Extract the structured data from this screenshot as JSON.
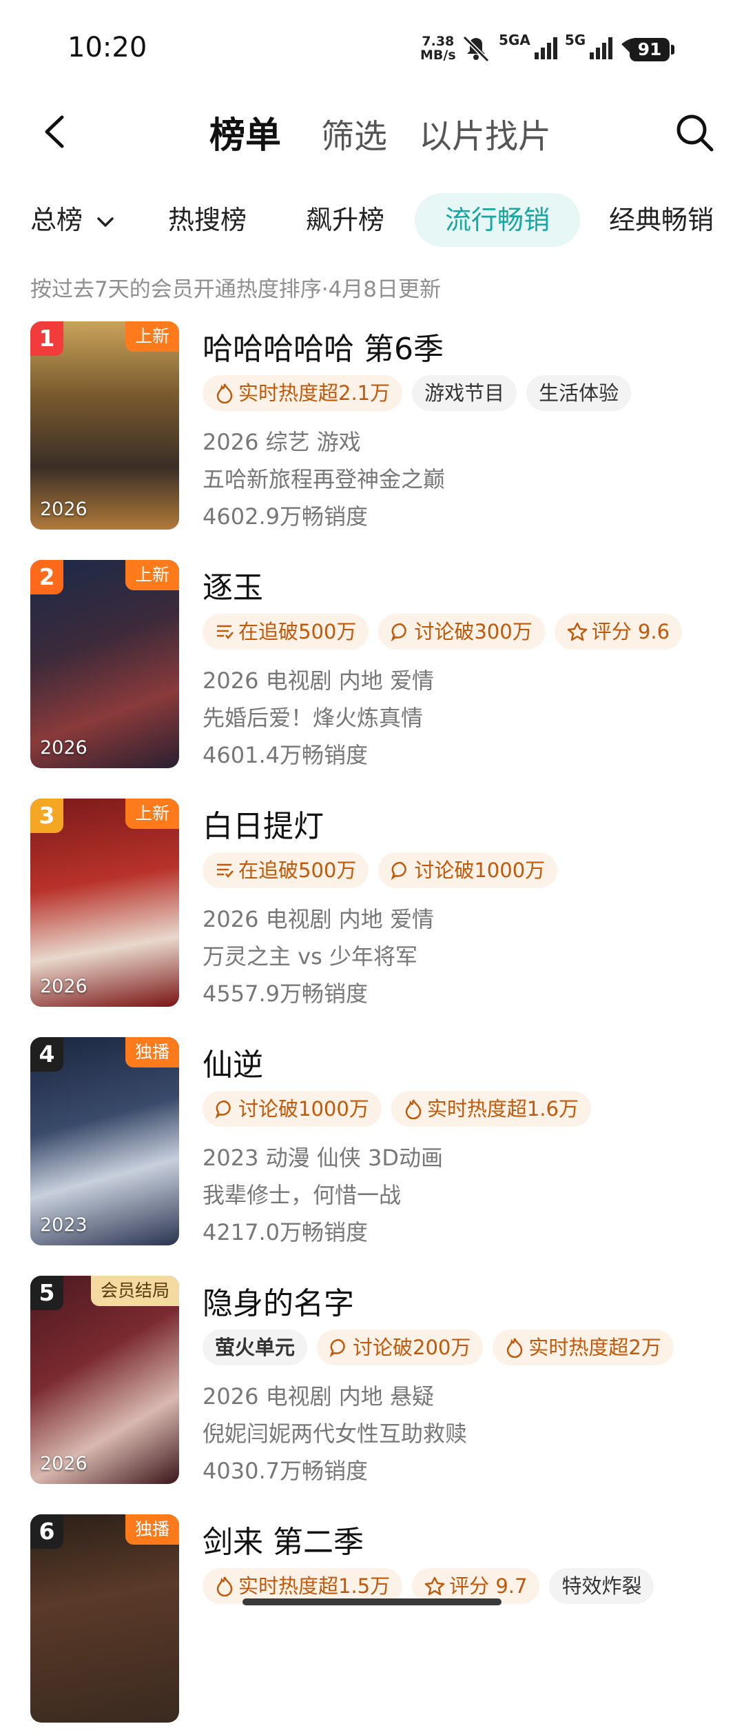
{
  "status": {
    "time": "10:20",
    "net_speed_value": "7.38",
    "net_speed_unit": "MB/s",
    "sim1_label": "5GA",
    "sim2_label": "5G",
    "wifi_label": "6",
    "battery": "91"
  },
  "header": {
    "tabs": [
      "榜单",
      "筛选",
      "以片找片"
    ]
  },
  "categories": [
    "总榜",
    "热搜榜",
    "飙升榜",
    "流行畅销",
    "经典畅销"
  ],
  "subtitle": "按过去7天的会员开通热度排序·4月8日更新",
  "items": [
    {
      "rank": "1",
      "badge": "上新",
      "year": "2026",
      "title": "哈哈哈哈哈 第6季",
      "tags": [
        {
          "icon": "flame-icon",
          "text": "实时热度超2.1万",
          "style": "hot"
        },
        {
          "icon": "",
          "text": "游戏节目",
          "style": "plain"
        },
        {
          "icon": "",
          "text": "生活体验",
          "style": "plain"
        }
      ],
      "meta": "2026 综艺 游戏",
      "desc": "五哈新旅程再登神金之巅",
      "sales": "4602.9万畅销度"
    },
    {
      "rank": "2",
      "badge": "上新",
      "year": "2026",
      "title": "逐玉",
      "tags": [
        {
          "icon": "list-icon",
          "text": "在追破500万",
          "style": "hot"
        },
        {
          "icon": "chat-icon",
          "text": "讨论破300万",
          "style": "hot"
        },
        {
          "icon": "star-icon",
          "text": "评分 9.6",
          "style": "hot"
        }
      ],
      "meta": "2026 电视剧 内地 爱情",
      "desc": "先婚后爱！烽火炼真情",
      "sales": "4601.4万畅销度"
    },
    {
      "rank": "3",
      "badge": "上新",
      "year": "2026",
      "title": "白日提灯",
      "tags": [
        {
          "icon": "list-icon",
          "text": "在追破500万",
          "style": "hot"
        },
        {
          "icon": "chat-icon",
          "text": "讨论破1000万",
          "style": "hot"
        }
      ],
      "meta": "2026 电视剧 内地 爱情",
      "desc": "万灵之主 vs 少年将军",
      "sales": "4557.9万畅销度"
    },
    {
      "rank": "4",
      "badge": "独播",
      "year": "2023",
      "title": "仙逆",
      "tags": [
        {
          "icon": "chat-icon",
          "text": "讨论破1000万",
          "style": "hot"
        },
        {
          "icon": "flame-icon",
          "text": "实时热度超1.6万",
          "style": "hot"
        }
      ],
      "meta": "2023 动漫 仙侠 3D动画",
      "desc": "我辈修士，何惜一战",
      "sales": "4217.0万畅销度"
    },
    {
      "rank": "5",
      "badge": "会员结局",
      "year": "2026",
      "title": "隐身的名字",
      "tags": [
        {
          "icon": "",
          "text": "萤火单元",
          "style": "plain"
        },
        {
          "icon": "chat-icon",
          "text": "讨论破200万",
          "style": "hot"
        },
        {
          "icon": "flame-icon",
          "text": "实时热度超2万",
          "style": "hot"
        }
      ],
      "meta": "2026 电视剧 内地 悬疑",
      "desc": "倪妮闫妮两代女性互助救赎",
      "sales": "4030.7万畅销度"
    },
    {
      "rank": "6",
      "badge": "独播",
      "year": "",
      "title": "剑来 第二季",
      "tags": [
        {
          "icon": "flame-icon",
          "text": "实时热度超1.5万",
          "style": "hot"
        },
        {
          "icon": "star-icon",
          "text": "评分 9.7",
          "style": "hot"
        },
        {
          "icon": "",
          "text": "特效炸裂",
          "style": "plain"
        }
      ],
      "meta": "",
      "desc": "",
      "sales": ""
    }
  ],
  "colors": {
    "accent": "#17a6a0",
    "rank1": "#f23b3b",
    "rank2": "#ff6a1a",
    "rank3": "#f5a623",
    "rank_other": "#1f1f1f",
    "hot_tag_bg": "#fdf2e7",
    "hot_tag_text": "#c05a0a"
  }
}
